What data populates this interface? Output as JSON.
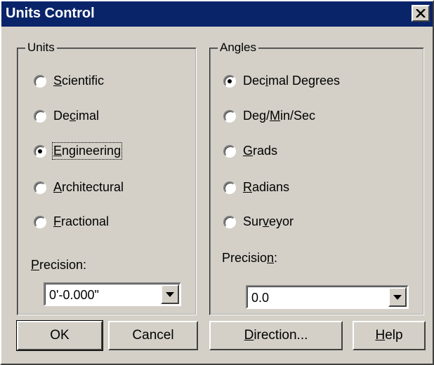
{
  "window": {
    "title": "Units Control",
    "close_glyph": "✕"
  },
  "units": {
    "group_label": "Units",
    "options": [
      {
        "pre": "",
        "key": "S",
        "post": "cientific",
        "selected": false
      },
      {
        "pre": "De",
        "key": "c",
        "post": "imal",
        "selected": false
      },
      {
        "pre": "",
        "key": "E",
        "post": "ngineering",
        "selected": true
      },
      {
        "pre": "",
        "key": "A",
        "post": "rchitectural",
        "selected": false
      },
      {
        "pre": "",
        "key": "F",
        "post": "ractional",
        "selected": false
      }
    ],
    "precision_label": {
      "pre": "",
      "key": "P",
      "post": "recision:"
    },
    "precision_value": "0'-0.000\""
  },
  "angles": {
    "group_label": "Angles",
    "options": [
      {
        "pre": "Dec",
        "key": "i",
        "post": "mal Degrees",
        "selected": true
      },
      {
        "pre": "Deg/",
        "key": "M",
        "post": "in/Sec",
        "selected": false
      },
      {
        "pre": "",
        "key": "G",
        "post": "rads",
        "selected": false
      },
      {
        "pre": "",
        "key": "R",
        "post": "adians",
        "selected": false
      },
      {
        "pre": "Sur",
        "key": "v",
        "post": "eyor",
        "selected": false
      }
    ],
    "precision_label": {
      "pre": "Precisio",
      "key": "n",
      "post": ":"
    },
    "precision_value": "0.0"
  },
  "buttons": {
    "ok": "OK",
    "cancel": "Cancel",
    "direction": {
      "pre": "",
      "key": "D",
      "post": "irection..."
    },
    "help": {
      "pre": "",
      "key": "H",
      "post": "elp"
    }
  },
  "colors": {
    "title_bar": "#0a246a",
    "dialog_face": "#d4d0c8"
  }
}
